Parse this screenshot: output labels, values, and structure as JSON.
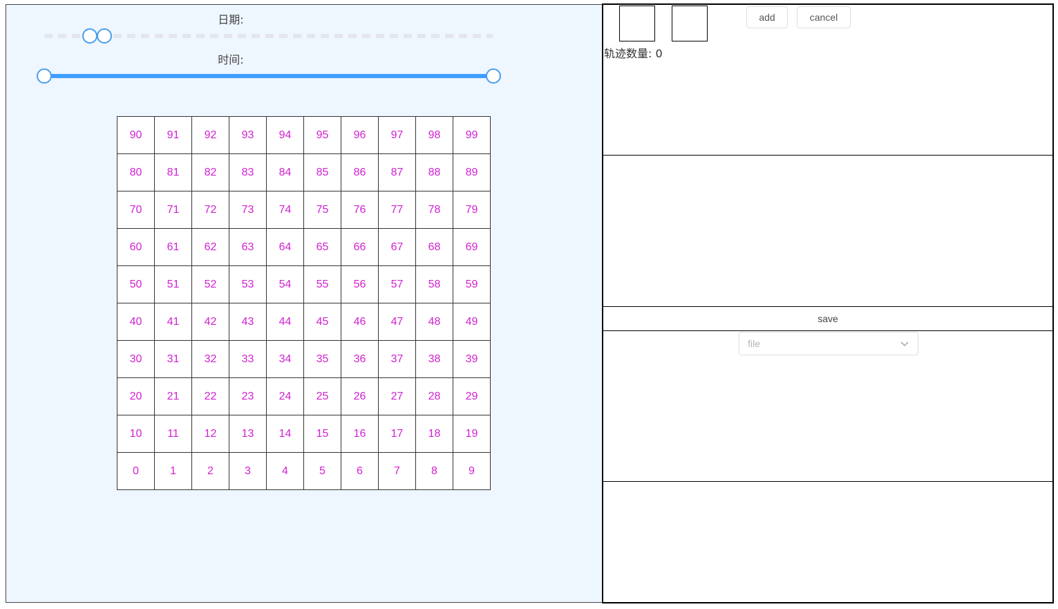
{
  "sliders": {
    "date_label": "日期:",
    "time_label": "时间:",
    "date_range": {
      "start_fraction": 0.1,
      "end_fraction": 0.13
    },
    "time_range": {
      "start_fraction": 0.0,
      "end_fraction": 1.0
    }
  },
  "grid": {
    "rows": [
      [
        "90",
        "91",
        "92",
        "93",
        "94",
        "95",
        "96",
        "97",
        "98",
        "99"
      ],
      [
        "80",
        "81",
        "82",
        "83",
        "84",
        "85",
        "86",
        "87",
        "88",
        "89"
      ],
      [
        "70",
        "71",
        "72",
        "73",
        "74",
        "75",
        "76",
        "77",
        "78",
        "79"
      ],
      [
        "60",
        "61",
        "62",
        "63",
        "64",
        "65",
        "66",
        "67",
        "68",
        "69"
      ],
      [
        "50",
        "51",
        "52",
        "53",
        "54",
        "55",
        "56",
        "57",
        "58",
        "59"
      ],
      [
        "40",
        "41",
        "42",
        "43",
        "44",
        "45",
        "46",
        "47",
        "48",
        "49"
      ],
      [
        "30",
        "31",
        "32",
        "33",
        "34",
        "35",
        "36",
        "37",
        "38",
        "39"
      ],
      [
        "20",
        "21",
        "22",
        "23",
        "24",
        "25",
        "26",
        "27",
        "28",
        "29"
      ],
      [
        "10",
        "11",
        "12",
        "13",
        "14",
        "15",
        "16",
        "17",
        "18",
        "19"
      ],
      [
        "0",
        "1",
        "2",
        "3",
        "4",
        "5",
        "6",
        "7",
        "8",
        "9"
      ]
    ],
    "text_color": "#d21fd2"
  },
  "toolbar": {
    "add_label": "add",
    "cancel_label": "cancel",
    "track_count_label": "轨迹数量:",
    "track_count": "0"
  },
  "save_label": "save",
  "file_select": {
    "placeholder": "file"
  },
  "colors": {
    "accent": "#409eff",
    "left_bg": "#eef6ff"
  }
}
